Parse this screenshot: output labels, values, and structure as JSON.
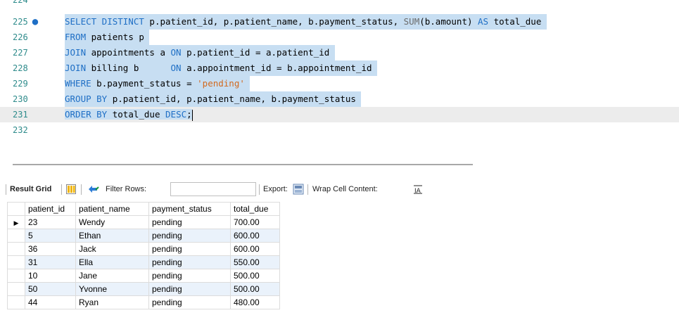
{
  "editor": {
    "lines": [
      {
        "num": "224",
        "text": ""
      },
      {
        "num": "225",
        "text": "SELECT DISTINCT p.patient_id, p.patient_name, b.payment_status, SUM(b.amount) AS total_due"
      },
      {
        "num": "226",
        "text": "FROM patients p"
      },
      {
        "num": "227",
        "text": "JOIN appointments a ON p.patient_id = a.patient_id"
      },
      {
        "num": "228",
        "text": "JOIN billing b      ON a.appointment_id = b.appointment_id"
      },
      {
        "num": "229",
        "text": "WHERE b.payment_status = 'pending'"
      },
      {
        "num": "230",
        "text": "GROUP BY p.patient_id, p.patient_name, b.payment_status"
      },
      {
        "num": "231",
        "text": "ORDER BY total_due DESC;"
      },
      {
        "num": "232",
        "text": ""
      }
    ]
  },
  "toolbar": {
    "result_grid_label": "Result Grid",
    "filter_rows_label": "Filter Rows:",
    "filter_value": "",
    "export_label": "Export:",
    "wrap_label": "Wrap Cell Content:"
  },
  "grid": {
    "columns": [
      "patient_id",
      "patient_name",
      "payment_status",
      "total_due"
    ],
    "rows": [
      [
        "23",
        "Wendy",
        "pending",
        "700.00"
      ],
      [
        "5",
        "Ethan",
        "pending",
        "600.00"
      ],
      [
        "36",
        "Jack",
        "pending",
        "600.00"
      ],
      [
        "31",
        "Ella",
        "pending",
        "550.00"
      ],
      [
        "10",
        "Jane",
        "pending",
        "500.00"
      ],
      [
        "50",
        "Yvonne",
        "pending",
        "500.00"
      ],
      [
        "44",
        "Ryan",
        "pending",
        "480.00"
      ]
    ]
  },
  "colors": {
    "keyword": "#1f6fc5",
    "selection": "#c7def2",
    "string": "#d2691e",
    "line_number": "#2e8b8b"
  },
  "icons": [
    "breakpoint-dot-icon",
    "grid-layout-icon",
    "filter-refresh-icon",
    "export-icon",
    "wrap-cell-icon",
    "current-row-arrow-icon"
  ]
}
